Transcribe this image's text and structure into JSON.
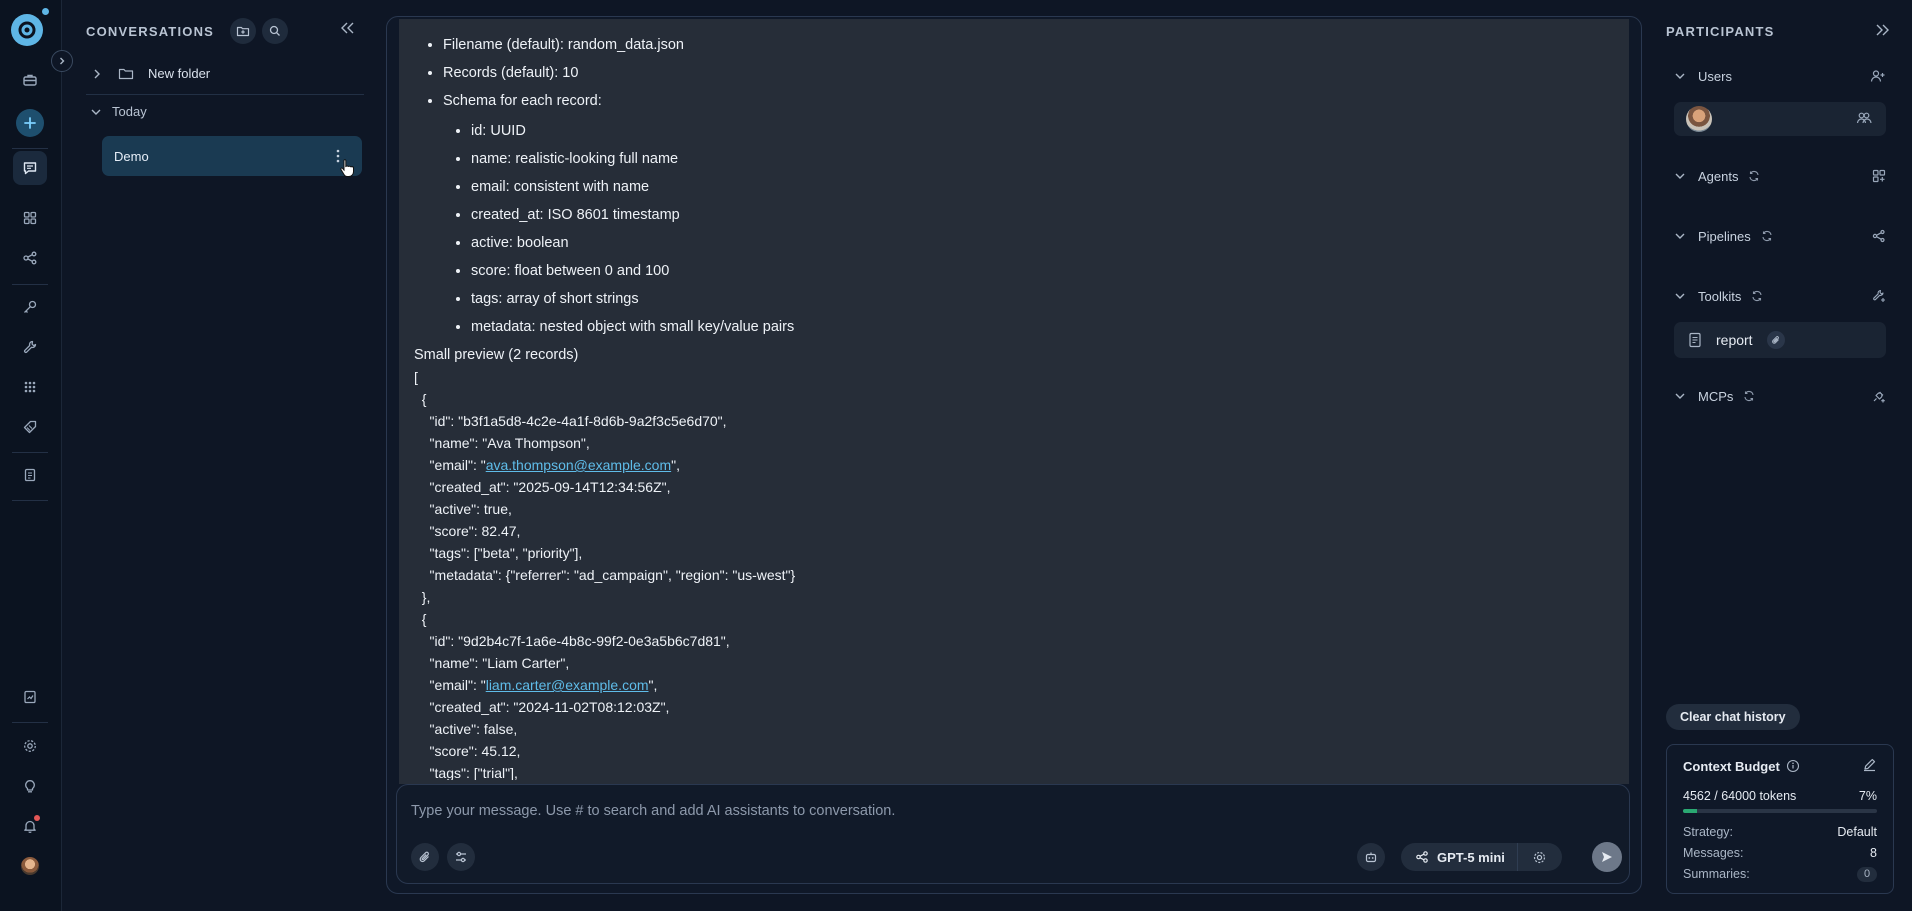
{
  "conversations": {
    "title": "CONVERSATIONS",
    "folder_label": "New folder",
    "group_label": "Today",
    "item_label": "Demo"
  },
  "chat": {
    "bullets": [
      "Filename (default): random_data.json",
      "Records (default): 10",
      "Schema for each record:"
    ],
    "schema": [
      "id: UUID",
      "name: realistic-looking full name",
      "email: consistent with name",
      "created_at: ISO 8601 timestamp",
      "active: boolean",
      "score: float between 0 and 100",
      "tags: array of short strings",
      "metadata: nested object with small key/value pairs"
    ],
    "preview_title": "Small preview (2 records)",
    "code": {
      "open_bracket": "[",
      "open_brace": "  {",
      "r1_id": "    \"id\": \"b3f1a5d8-4c2e-4a1f-8d6b-9a2f3c5e6d70\",",
      "r1_name": "    \"name\": \"Ava Thompson\",",
      "r1_email_pre": "    \"email\": \"",
      "r1_email_link": "ava.thompson@example.com",
      "r1_email_post": "\",",
      "r1_created": "    \"created_at\": \"2025-09-14T12:34:56Z\",",
      "r1_active": "    \"active\": true,",
      "r1_score": "    \"score\": 82.47,",
      "r1_tags": "    \"tags\": [\"beta\", \"priority\"],",
      "r1_meta": "    \"metadata\": {\"referrer\": \"ad_campaign\", \"region\": \"us-west\"}",
      "close_brace_comma": "  },",
      "open_brace2": "  {",
      "r2_id": "    \"id\": \"9d2b4c7f-1a6e-4b8c-99f2-0e3a5b6c7d81\",",
      "r2_name": "    \"name\": \"Liam Carter\",",
      "r2_email_pre": "    \"email\": \"",
      "r2_email_link": "liam.carter@example.com",
      "r2_email_post": "\",",
      "r2_created": "    \"created_at\": \"2024-11-02T08:12:03Z\",",
      "r2_active": "    \"active\": false,",
      "r2_score": "    \"score\": 45.12,",
      "r2_tags": "    \"tags\": [\"trial\"],"
    }
  },
  "composer": {
    "placeholder": "Type your message. Use # to search and add AI assistants to conversation.",
    "model_label": "GPT-5 mini"
  },
  "participants": {
    "title": "PARTICIPANTS",
    "sections": {
      "users": "Users",
      "agents": "Agents",
      "pipelines": "Pipelines",
      "toolkits": "Toolkits",
      "mcps": "MCPs"
    },
    "toolkit_item": "report",
    "clear_label": "Clear chat history",
    "budget": {
      "title": "Context Budget",
      "tokens": "4562 / 64000 tokens",
      "percent": "7%",
      "percent_value": 0.07,
      "strategy_label": "Strategy:",
      "strategy_value": "Default",
      "messages_label": "Messages:",
      "messages_value": "8",
      "summaries_label": "Summaries:",
      "summaries_value": "0"
    }
  },
  "colors": {
    "accent": "#5fb6e6",
    "active_item": "#1a3a52",
    "progress": "#2aa872",
    "notification": "#e45757"
  },
  "icons": {
    "rail": [
      "briefcase-icon",
      "plus-icon",
      "chat-icon",
      "grid-icon",
      "flow-icon",
      "key-icon",
      "wrench-icon",
      "apps-icon",
      "tag-icon",
      "document-icon",
      "report-icon",
      "settings-icon",
      "bulb-icon",
      "bell-icon",
      "avatar"
    ]
  }
}
